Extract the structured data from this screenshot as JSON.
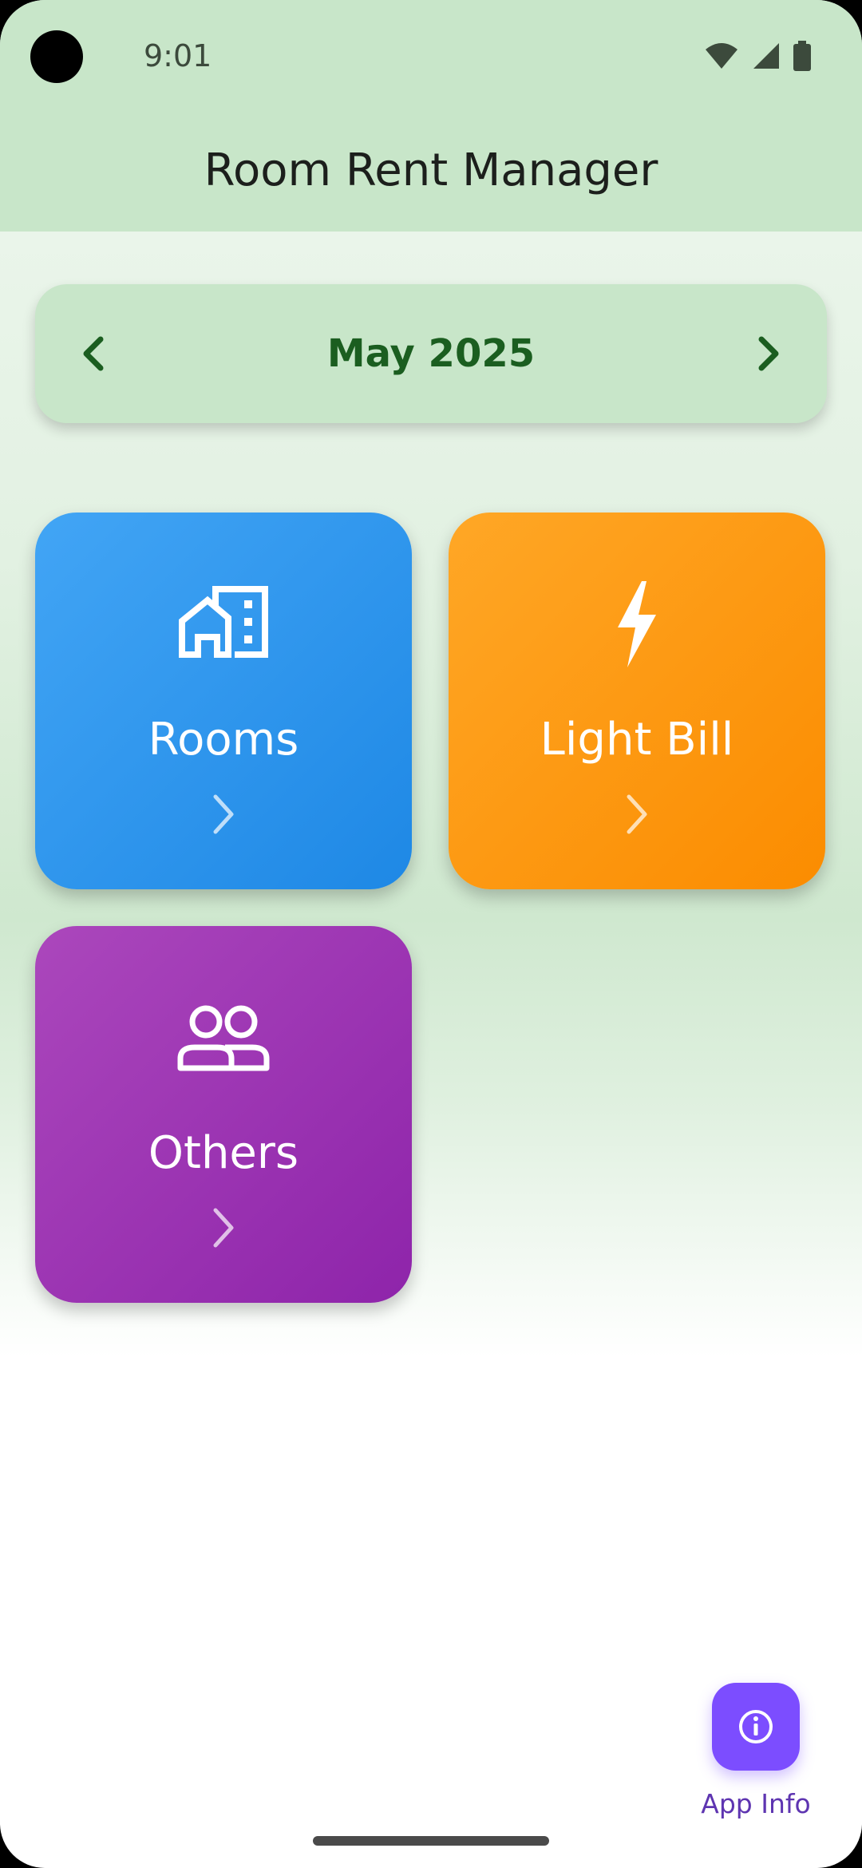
{
  "status_bar": {
    "time": "9:01",
    "icons": [
      "wifi-icon",
      "signal-icon",
      "battery-icon"
    ]
  },
  "app_bar": {
    "title": "Room Rent Manager"
  },
  "month_selector": {
    "label": "May 2025",
    "prev_icon": "chevron-left-icon",
    "next_icon": "chevron-right-icon"
  },
  "tiles": [
    {
      "label": "Rooms",
      "icon": "building-icon",
      "color": "#1e88e5"
    },
    {
      "label": "Light Bill",
      "icon": "lightning-icon",
      "color": "#fb8c00"
    },
    {
      "label": "Others",
      "icon": "people-icon",
      "color": "#8e24aa"
    }
  ],
  "fab": {
    "label": "App Info",
    "icon": "info-icon",
    "color": "#7c4dff"
  },
  "colors": {
    "app_bar_bg": "#c8e6c9",
    "month_text": "#1b5e20"
  }
}
